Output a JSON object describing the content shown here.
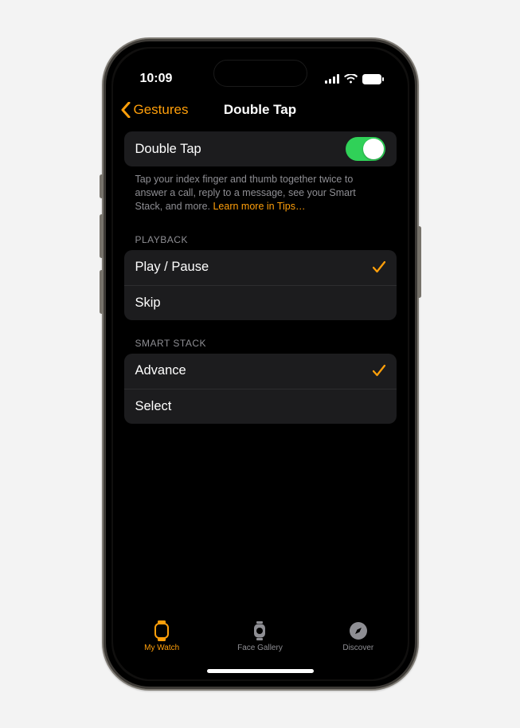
{
  "status": {
    "time": "10:09"
  },
  "nav": {
    "back_label": "Gestures",
    "title": "Double Tap"
  },
  "main_toggle": {
    "label": "Double Tap",
    "on": true
  },
  "footer": {
    "text": "Tap your index finger and thumb together twice to answer a call, reply to a message, see your Smart Stack, and more. ",
    "link": "Learn more in Tips…"
  },
  "sections": {
    "playback": {
      "header": "PLAYBACK",
      "options": [
        {
          "label": "Play / Pause",
          "selected": true
        },
        {
          "label": "Skip",
          "selected": false
        }
      ]
    },
    "smart_stack": {
      "header": "SMART STACK",
      "options": [
        {
          "label": "Advance",
          "selected": true
        },
        {
          "label": "Select",
          "selected": false
        }
      ]
    }
  },
  "tabs": [
    {
      "label": "My Watch",
      "icon": "watch-icon",
      "active": true
    },
    {
      "label": "Face Gallery",
      "icon": "gallery-icon",
      "active": false
    },
    {
      "label": "Discover",
      "icon": "compass-icon",
      "active": false
    }
  ],
  "colors": {
    "accent": "#ff9f0a",
    "toggle_on": "#30d158",
    "cell_bg": "#1c1c1e"
  }
}
